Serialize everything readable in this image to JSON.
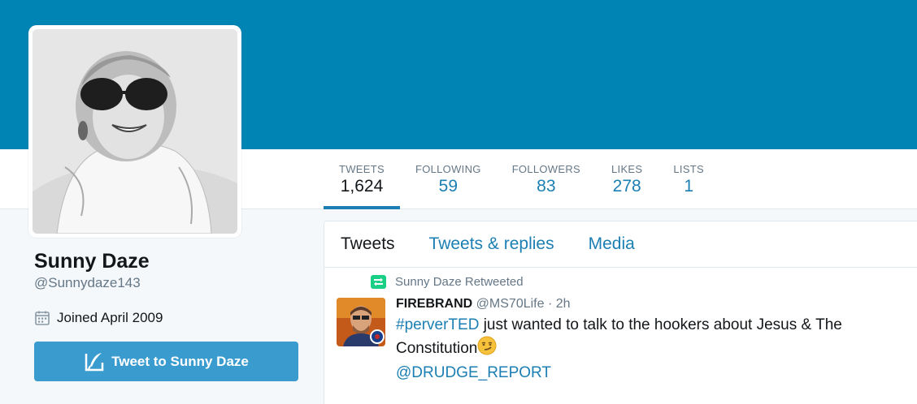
{
  "profile": {
    "name": "Sunny Daze",
    "handle": "@Sunnydaze143",
    "joined": "Joined April 2009",
    "tweet_to_label": "Tweet to Sunny Daze"
  },
  "stats": [
    {
      "label": "TWEETS",
      "value": "1,624"
    },
    {
      "label": "FOLLOWING",
      "value": "59"
    },
    {
      "label": "FOLLOWERS",
      "value": "83"
    },
    {
      "label": "LIKES",
      "value": "278"
    },
    {
      "label": "LISTS",
      "value": "1"
    }
  ],
  "tabs": [
    {
      "label": "Tweets"
    },
    {
      "label": "Tweets & replies"
    },
    {
      "label": "Media"
    }
  ],
  "tweet": {
    "retweet_context": "Sunny Daze Retweeted",
    "author_name": "FIREBRAND",
    "author_handle": "@MS70Life",
    "separator": " · ",
    "time": "2h",
    "hashtag": "#perverTED",
    "text": " just wanted to talk to the hookers about Jesus & The Constitution",
    "mention": "@DRUDGE_REPORT"
  },
  "colors": {
    "banner": "#0084b4",
    "link": "#1c7fb3",
    "button": "#3a9bcf",
    "retweet": "#19cf86"
  }
}
